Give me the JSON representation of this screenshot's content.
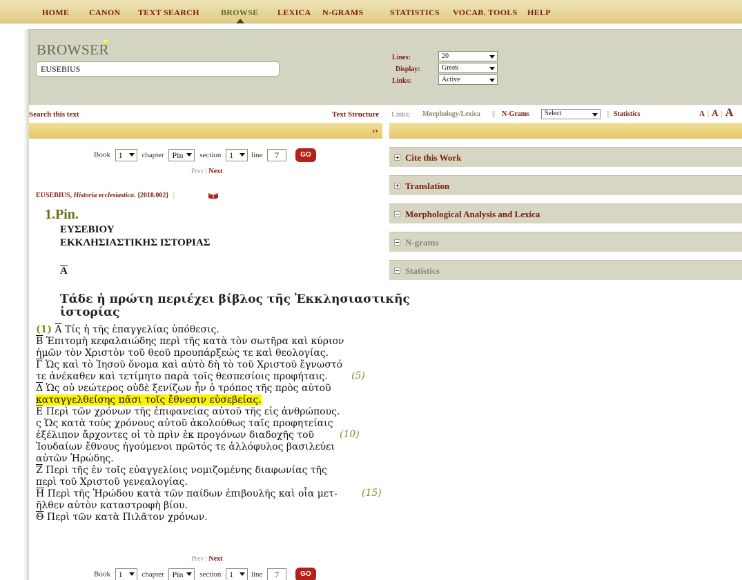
{
  "nav": {
    "items": [
      "HOME",
      "CANON",
      "TEXT SEARCH",
      "BROWSE",
      "LEXICA",
      "N-GRAMS",
      "STATISTICS",
      "VOCAB. TOOLS",
      "HELP"
    ],
    "active": "BROWSE"
  },
  "browser": {
    "title": "BROWSER",
    "text_input_value": "EUSEBIUS",
    "options": [
      {
        "label": "Lines:",
        "value": "20"
      },
      {
        "label": "Display:",
        "value": "Greek"
      },
      {
        "label": "Links:",
        "value": "Active"
      }
    ]
  },
  "toolbar": {
    "search_this_text": "Search this text",
    "text_structure": "Text Structure",
    "links_label": "Links:",
    "morphology": "Morphology/Lexica",
    "sep": "||",
    "ngrams": "N-Grams",
    "select_value": "Select",
    "statistics": "Statistics",
    "font_small": "A",
    "font_medium": "A",
    "font_large": "A",
    "divider": "|",
    "expand": "››"
  },
  "location": {
    "book_label": "Book",
    "book": "1",
    "chapter_label": "chapter",
    "chapter": "Pin",
    "section_label": "section",
    "section": "1",
    "line_label": "line",
    "line": "7",
    "go": "GO",
    "prev": "Prev",
    "pipe": "|",
    "next": "Next"
  },
  "citation": {
    "author": "EUSEBIUS,",
    "work": "Historia ecclesiastica",
    "id": ". {2018.002}",
    "divider": "|"
  },
  "text": {
    "section_heading": "1.Pin.",
    "head1": "ΕΥΣΕΒΙΟΥ",
    "head2": "ΕΚΚΛΗΣΙΑΣΤΙΚΗΣ ΙΣΤΟΡΙΑΣ",
    "book_numeral": "Α",
    "title1": "Τάδε ἡ πρώτη περιέχει βίβλος τῆς Ἐκκλησιαστικῆς",
    "title2": "ἱστορίας",
    "line1_num": "(1)",
    "line1_numeral": "Α",
    "line1": " Τίς ἡ τῆς ἐπαγγελίας ὑπόθεσις.",
    "line2_numeral": "Β",
    "line2": " Ἐπιτομὴ κεφαλαιώδης περὶ τῆς κατὰ τὸν σωτῆρα καὶ κύριον",
    "line3": "ἡμῶν τὸν Χριστὸν τοῦ θεοῦ προυπάρξεώς τε καὶ θεολογίας.",
    "line4_numeral": "Γ",
    "line4": " Ὡς καὶ τὸ Ἰησοῦ ὄνομα καὶ αὐτὸ δὴ τὸ τοῦ Χριστοῦ ἔγνωστό",
    "line5": "τε ἀνέκαθεν καὶ τετίμητο παρὰ τοῖς θεσπεσίοις προφήταις.",
    "line5_num": "(5)",
    "line6_numeral": "Δ",
    "line6": " Ὡς οὐ νεώτερος οὐδὲ ξενίζων ἦν ὁ τρόπος τῆς πρὸς αὐτοῦ",
    "line7": "καταγγελθείσης πᾶσι τοῖς ἔθνεσιν εὐσεβείας.",
    "line8_numeral": "Ε",
    "line8": " Περὶ τῶν χρόνων τῆς ἐπιφανείας αὐτοῦ τῆς εἰς ἀνθρώπους.",
    "line9_numeral": "ς",
    "line9": " Ὡς κατὰ τοὺς χρόνους αὐτοῦ ἀκολούθως ταῖς προφητείαις",
    "line10": "ἐξέλιπον ἄρχοντες οἱ τὸ πρὶν ἐκ προγόνων διαδοχῆς τοῦ",
    "line10_num": "(10)",
    "line11": "Ἰουδαίων ἔθνους ἡγούμενοι πρῶτός τε ἀλλόφυλος βασιλεύει",
    "line12": "αὐτῶν Ἡρώδης.",
    "line13_numeral": "Ζ",
    "line13": " Περὶ τῆς ἐν τοῖς εὐαγγελίοις νομιζομένης διαφωνίας τῆς",
    "line14": "περὶ τοῦ Χριστοῦ γενεαλογίας.",
    "line15_numeral": "Η",
    "line15": " Περὶ τῆς Ἡρώδου κατὰ τῶν παίδων ἐπιβουλῆς καὶ οἷα μετ-",
    "line15_num": "(15)",
    "line16": "ῆλθεν αὐτὸν καταστροφὴ βίου.",
    "line17_numeral": "Θ",
    "line17": " Περὶ τῶν κατὰ Πιλᾶτον χρόνων."
  },
  "panels": [
    {
      "label": "Cite this Work",
      "state": "collapsed"
    },
    {
      "label": "Translation",
      "state": "collapsed"
    },
    {
      "label": "Morphological Analysis and Lexica",
      "state": "expanded"
    },
    {
      "label": "N-grams",
      "state": "expanded"
    },
    {
      "label": "Statistics",
      "state": "expanded"
    }
  ],
  "colors": {
    "accent": "#7a1a10",
    "olive": "#6a6a18",
    "highlight": "#fff200",
    "go_button": "#b3211d"
  }
}
